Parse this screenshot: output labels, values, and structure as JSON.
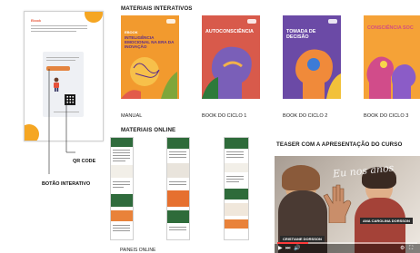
{
  "headings": {
    "interactive": "MATERIAIS INTERATIVOS",
    "online": "MATERIAIS ONLINE",
    "teaser": "TEASER COM A APRESENTAÇÃO DO CURSO"
  },
  "ebook": {
    "title": "Ebook",
    "qr_label": "QR CODE",
    "button_label": "BOTÃO INTERATIVO"
  },
  "covers": [
    {
      "title_small": "EBOOK",
      "title": "INTELIGÊNCIA EMOCIONAL NA ERA DA INOVAÇÃO",
      "caption": "MANUAL"
    },
    {
      "title": "AUTOCONSCIÊNCIA",
      "caption": "BOOK DO CICLO 1"
    },
    {
      "title": "TOMADA DE DECISÃO",
      "caption": "BOOK DO CICLO 2"
    },
    {
      "title": "CONSCIÊNCIA SOC",
      "caption": "BOOK DO CICLO 3"
    }
  ],
  "online_caption": "PAINEIS ONLINE",
  "video": {
    "name_tag": "CRISTIANE DORSSON",
    "name_tag2": "ANA CAROLINA DORSSON",
    "overlay": "Eu nos anos"
  },
  "colors": {
    "orange": "#f0962e",
    "purple": "#5a3d8a",
    "teal": "#1f7a8c",
    "green": "#2e6b3a"
  }
}
